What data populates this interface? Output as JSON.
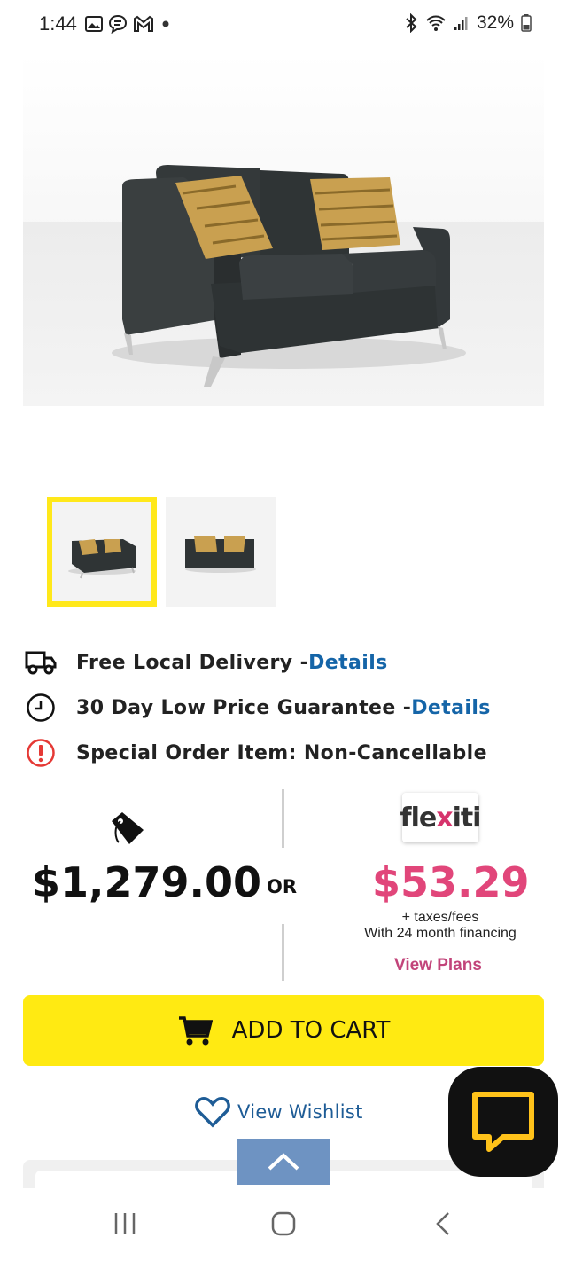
{
  "status_bar": {
    "time": "1:44",
    "battery": "32%",
    "icons": [
      "image-icon",
      "message-icon",
      "gmail-icon",
      "dot-icon",
      "bluetooth-icon",
      "wifi-icon",
      "signal-icon",
      "battery-icon"
    ]
  },
  "product": {
    "image_alt_icon": "loveseat-image",
    "thumbnails": [
      "thumbnail-front",
      "thumbnail-straight"
    ]
  },
  "features": [
    {
      "text": "Free Local Delivery - ",
      "link": "Details",
      "icon": "truck-icon"
    },
    {
      "text": "30 Day Low Price Guarantee - ",
      "link": "Details",
      "icon": "clock-icon"
    },
    {
      "text": "Special Order Item: Non-Cancellable",
      "icon": "alert-icon"
    }
  ],
  "pricing": {
    "price": "$1,279.00",
    "or_label": "OR",
    "flexiti_logo": "flexiti",
    "finance_price": "$53.29",
    "finance_note_1": "+ taxes/fees",
    "finance_note_2": "With 24 month financing",
    "view_plans": "View Plans"
  },
  "actions": {
    "add_to_cart": "ADD TO CART",
    "wishlist": "View Wishlist"
  },
  "colors": {
    "accent_yellow": "#ffea12",
    "link_blue": "#1565a8",
    "finance_pink": "#e1467a",
    "chat_bg": "#111111"
  }
}
